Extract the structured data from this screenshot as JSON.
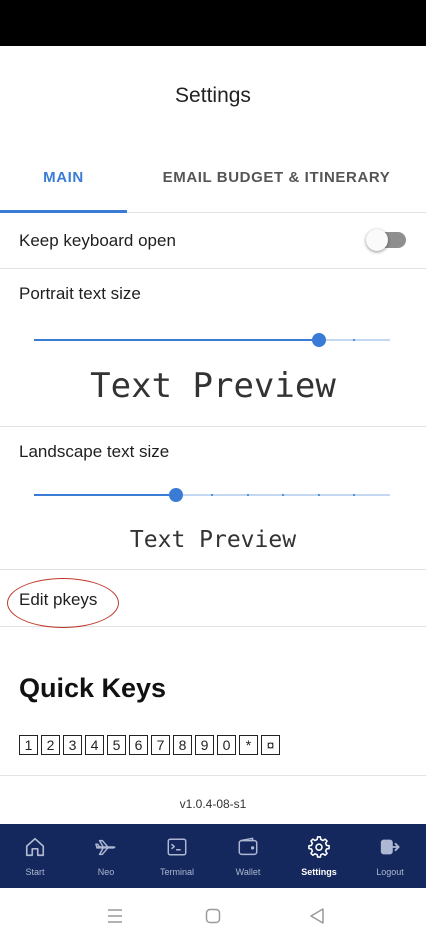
{
  "header": {
    "title": "Settings"
  },
  "tabs": [
    {
      "label": "MAIN",
      "active": true
    },
    {
      "label": "EMAIL BUDGET & ITINERARY",
      "active": false
    }
  ],
  "settings": {
    "keep_keyboard": {
      "label": "Keep keyboard open",
      "enabled": false
    },
    "portrait": {
      "label": "Portrait text size",
      "preview": "Text Preview",
      "level": 0.8
    },
    "landscape": {
      "label": "Landscape text size",
      "preview": "Text Preview",
      "level": 0.4
    },
    "edit_pkeys": {
      "label": "Edit pkeys",
      "highlight_color": "#c0392b"
    }
  },
  "quick_keys": {
    "title": "Quick Keys",
    "keys": [
      "1",
      "2",
      "3",
      "4",
      "5",
      "6",
      "7",
      "8",
      "9",
      "0",
      "*",
      "¤"
    ]
  },
  "version": "v1.0.4-08-s1",
  "bottom_nav": [
    {
      "label": "Start",
      "icon": "home-icon",
      "active": false
    },
    {
      "label": "Neo",
      "icon": "plane-icon",
      "active": false
    },
    {
      "label": "Terminal",
      "icon": "terminal-icon",
      "active": false
    },
    {
      "label": "Wallet",
      "icon": "wallet-icon",
      "active": false
    },
    {
      "label": "Settings",
      "icon": "gear-icon",
      "active": true
    },
    {
      "label": "Logout",
      "icon": "logout-icon",
      "active": false
    }
  ],
  "colors": {
    "accent": "#3a7bd5",
    "nav_background": "#15285d"
  }
}
